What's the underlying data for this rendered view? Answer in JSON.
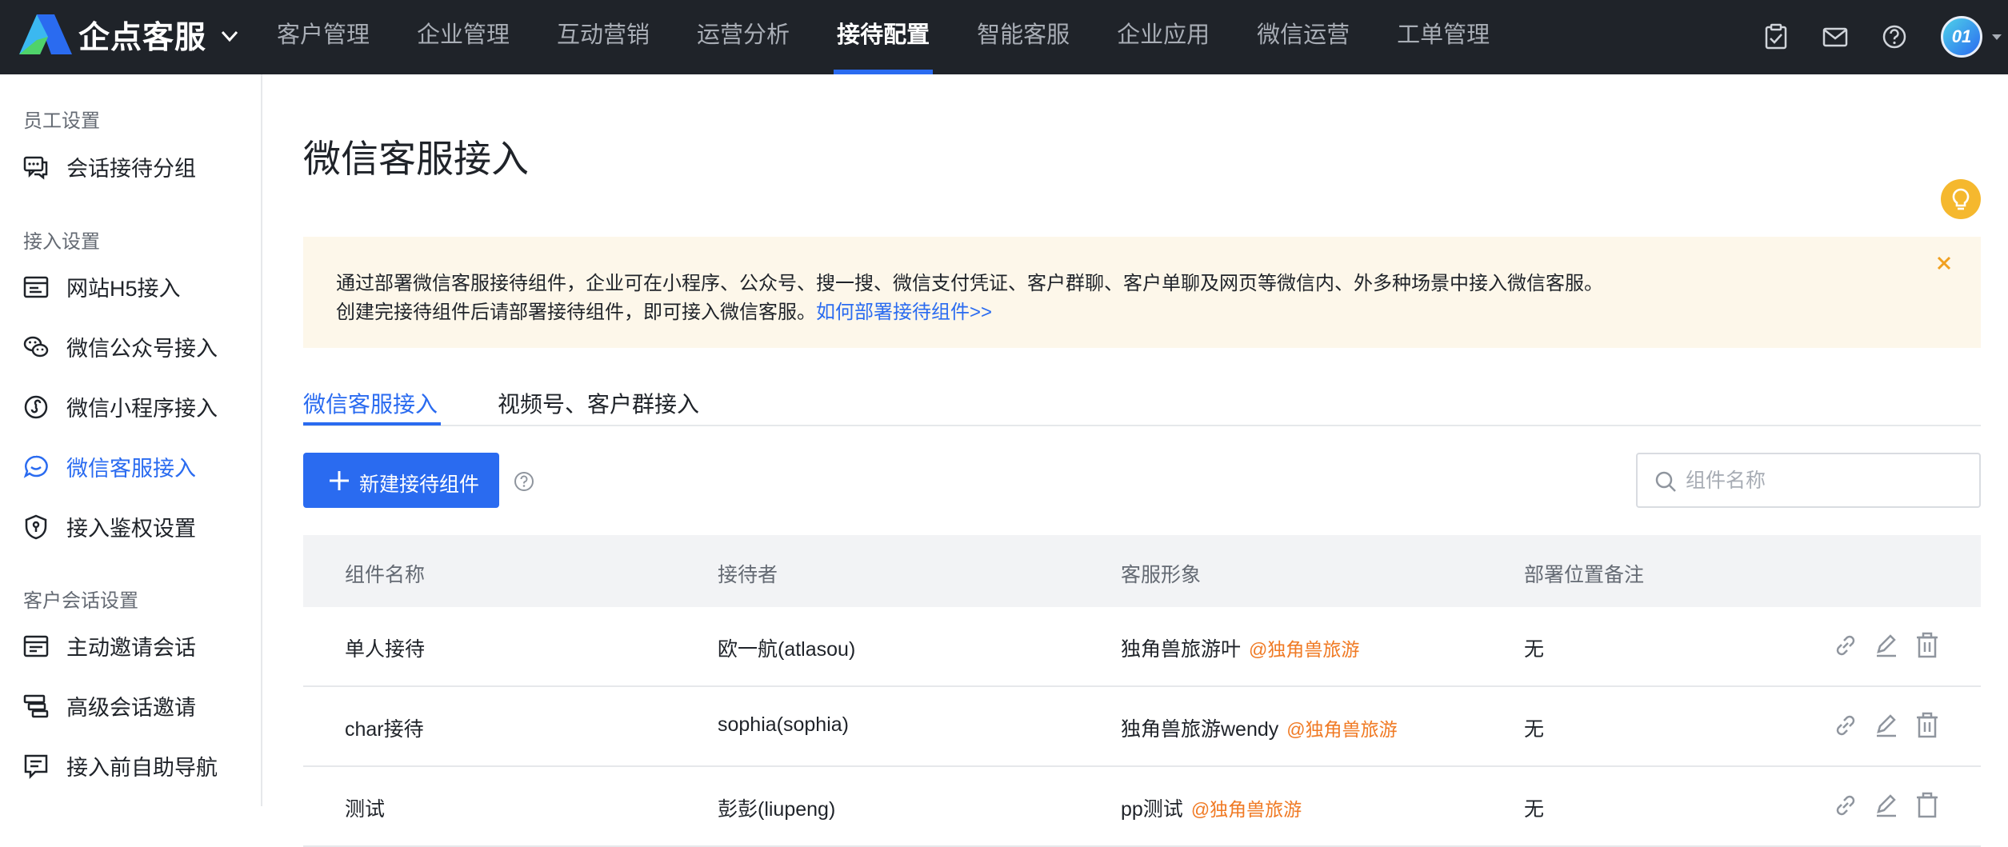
{
  "app": {
    "brand": "企点客服"
  },
  "topnav": {
    "items": [
      {
        "label": "客户管理"
      },
      {
        "label": "企业管理"
      },
      {
        "label": "互动营销"
      },
      {
        "label": "运营分析"
      },
      {
        "label": "接待配置",
        "active": true
      },
      {
        "label": "智能客服"
      },
      {
        "label": "企业应用"
      },
      {
        "label": "微信运营"
      },
      {
        "label": "工单管理"
      }
    ],
    "avatar_text": "01"
  },
  "sidebar": {
    "groups": [
      {
        "title": "员工设置",
        "items": [
          {
            "label": "会话接待分组",
            "icon": "chat-group-icon"
          }
        ]
      },
      {
        "title": "接入设置",
        "items": [
          {
            "label": "网站H5接入",
            "icon": "web-window-icon"
          },
          {
            "label": "微信公众号接入",
            "icon": "wechat-icon"
          },
          {
            "label": "微信小程序接入",
            "icon": "mini-program-icon"
          },
          {
            "label": "微信客服接入",
            "icon": "wechat-service-icon",
            "active": true
          },
          {
            "label": "接入鉴权设置",
            "icon": "shield-icon"
          }
        ]
      },
      {
        "title": "客户会话设置",
        "items": [
          {
            "label": "主动邀请会话",
            "icon": "invite-icon"
          },
          {
            "label": "高级会话邀请",
            "icon": "advanced-invite-icon"
          },
          {
            "label": "接入前自助导航",
            "icon": "navigation-icon"
          }
        ]
      }
    ]
  },
  "main": {
    "title": "微信客服接入",
    "notice": {
      "line1": "通过部署微信客服接待组件，企业可在小程序、公众号、搜一搜、微信支付凭证、客户群聊、客户单聊及网页等微信内、外多种场景中接入微信客服。",
      "line2": "创建完接待组件后请部署接待组件，即可接入微信客服。",
      "link": "如何部署接待组件>>"
    },
    "tabs": [
      {
        "label": "微信客服接入",
        "active": true
      },
      {
        "label": "视频号、客户群接入"
      }
    ],
    "new_button": "新建接待组件",
    "search_placeholder": "组件名称",
    "table": {
      "columns": [
        "组件名称",
        "接待者",
        "客服形象",
        "部署位置备注"
      ],
      "rows": [
        {
          "name": "单人接待",
          "receiver": "欧一航(atlasou)",
          "avatar": "独角兽旅游叶",
          "org": "@独角兽旅游",
          "note": "无"
        },
        {
          "name": "char接待",
          "receiver": "sophia(sophia)",
          "avatar": "独角兽旅游wendy",
          "org": "@独角兽旅游",
          "note": "无"
        },
        {
          "name": "测试",
          "receiver": "彭彭(liupeng)",
          "avatar": "pp测试",
          "org": "@独角兽旅游",
          "note": "无"
        }
      ]
    }
  },
  "colors": {
    "topbar": "#1f2329",
    "accent": "#2a6bf0",
    "notice_bg": "#fdf7ea",
    "org_tag": "#f07a24",
    "bulb": "#f5b82e"
  }
}
